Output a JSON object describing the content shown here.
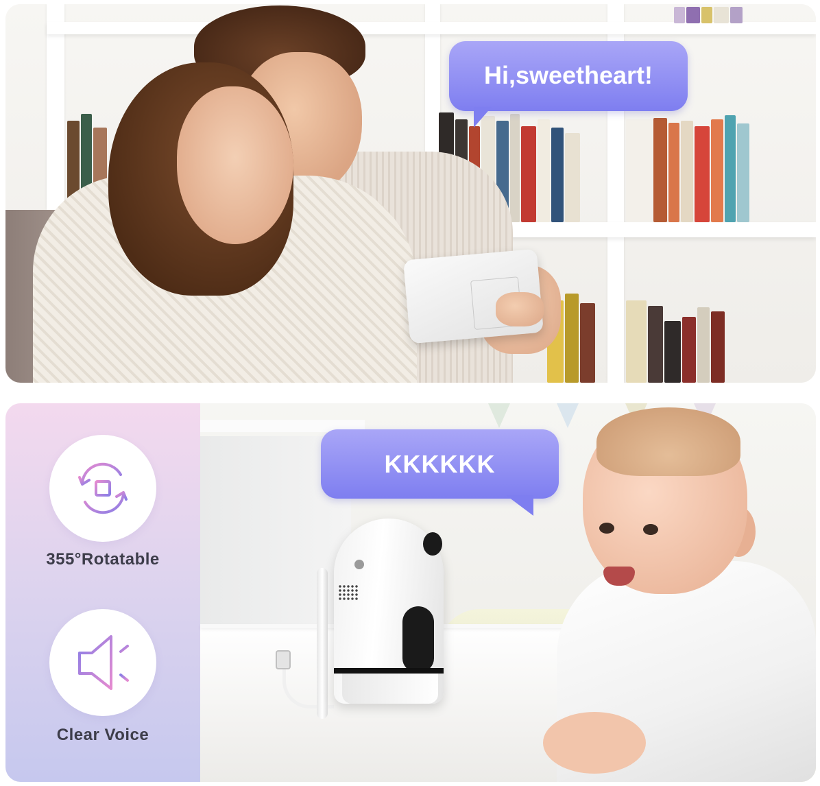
{
  "top_panel": {
    "speech_bubble": "Hi,sweetheart!"
  },
  "bottom_panel": {
    "speech_bubble": "KKKKKK",
    "features": [
      {
        "icon": "rotate-icon",
        "label": "355°Rotatable"
      },
      {
        "icon": "speaker-icon",
        "label": "Clear Voice"
      }
    ]
  },
  "colors": {
    "bubble_gradient_top": "#a9a6f7",
    "bubble_gradient_bottom": "#7e7ef0",
    "icon_purple": "#8a7ee6",
    "icon_pink": "#e58bd0",
    "strip_top": "#f3d9ee",
    "strip_bottom": "#c6c8ee",
    "label_text": "#3d3d4a"
  }
}
